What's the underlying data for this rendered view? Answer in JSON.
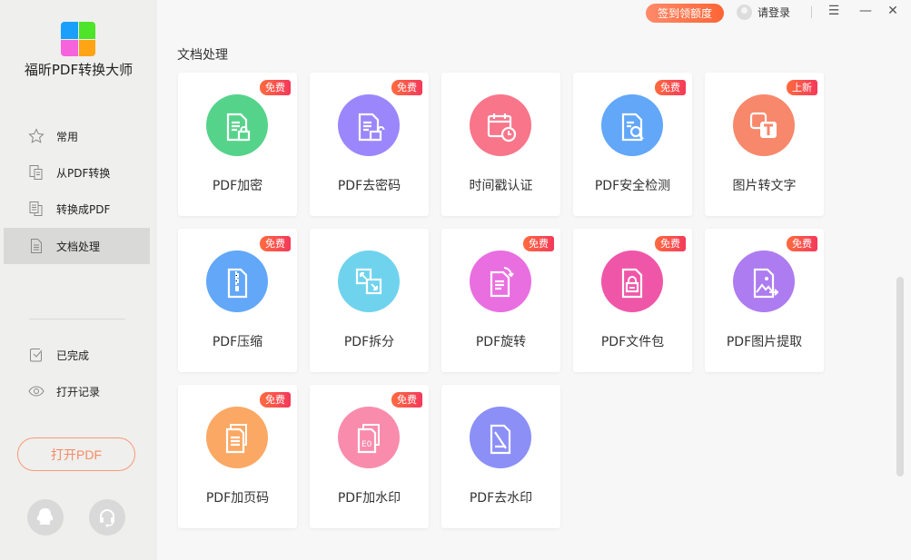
{
  "app": {
    "name": "福昕PDF转换大师",
    "logo_colors": [
      "#1aa0fb",
      "#4ee42a",
      "#f563dd",
      "#ffa414"
    ]
  },
  "topbar": {
    "sign_in_reward": "签到领额度",
    "login": "请登录",
    "menu_icon": "☰",
    "minimize_icon": "—",
    "close_icon": "✕"
  },
  "sidebar": {
    "items": [
      {
        "label": "常用",
        "icon": "star-icon"
      },
      {
        "label": "从PDF转换",
        "icon": "from-pdf-icon"
      },
      {
        "label": "转换成PDF",
        "icon": "to-pdf-icon"
      },
      {
        "label": "文档处理",
        "icon": "document-icon",
        "active": true
      }
    ],
    "bottom_items": [
      {
        "label": "已完成",
        "icon": "check-box-icon"
      },
      {
        "label": "打开记录",
        "icon": "eye-icon"
      }
    ],
    "open_pdf": "打开PDF"
  },
  "main": {
    "section_title": "文档处理",
    "tools": [
      {
        "label": "PDF加密",
        "badge": "免费",
        "color": "#56d38a",
        "icon": "lock-doc-icon"
      },
      {
        "label": "PDF去密码",
        "badge": "免费",
        "color": "#9b87fb",
        "icon": "unlock-doc-icon"
      },
      {
        "label": "时间戳认证",
        "badge": null,
        "color": "#f8758a",
        "icon": "calendar-clock-icon"
      },
      {
        "label": "PDF安全检测",
        "badge": "免费",
        "color": "#62a7f8",
        "icon": "scan-doc-icon"
      },
      {
        "label": "图片转文字",
        "badge": "上新",
        "color": "#f7886b",
        "icon": "image-text-icon"
      },
      {
        "label": "PDF压缩",
        "badge": "免费",
        "color": "#62a7f8",
        "icon": "zip-icon"
      },
      {
        "label": "PDF拆分",
        "badge": null,
        "color": "#6fd3ee",
        "icon": "split-icon"
      },
      {
        "label": "PDF旋转",
        "badge": "免费",
        "color": "#e96ee0",
        "icon": "rotate-icon"
      },
      {
        "label": "PDF文件包",
        "badge": "免费",
        "color": "#f056a8",
        "icon": "package-icon"
      },
      {
        "label": "PDF图片提取",
        "badge": "免费",
        "color": "#ad7cf0",
        "icon": "image-extract-icon"
      },
      {
        "label": "PDF加页码",
        "badge": "免费",
        "color": "#fba865",
        "icon": "page-number-icon"
      },
      {
        "label": "PDF加水印",
        "badge": "免费",
        "color": "#f98cad",
        "icon": "watermark-icon"
      },
      {
        "label": "PDF去水印",
        "badge": null,
        "color": "#8b8ff6",
        "icon": "remove-watermark-icon"
      }
    ]
  }
}
